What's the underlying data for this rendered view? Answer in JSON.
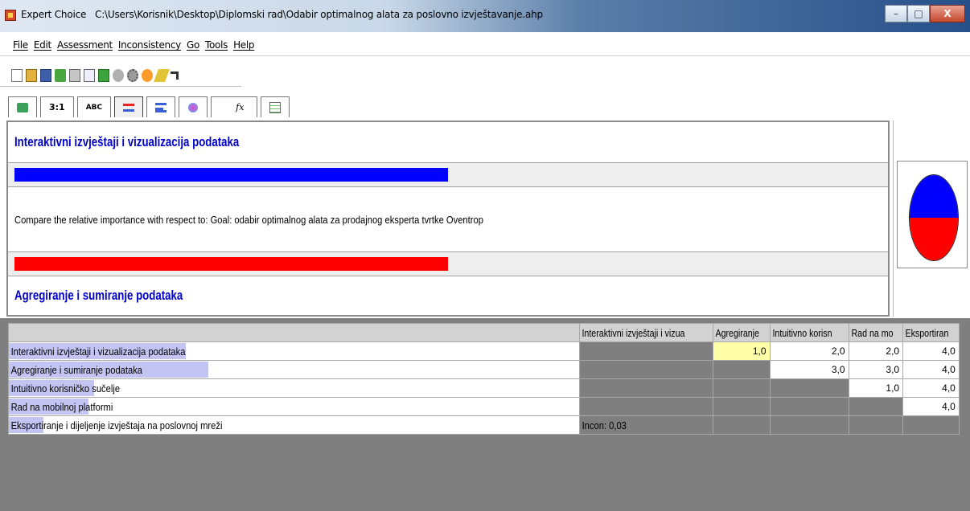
{
  "window": {
    "app_name": "Expert Choice",
    "path": "C:\\Users\\Korisnik\\Desktop\\Diplomski rad\\Odabir optimalnog alata za poslovno izvještavanje.ahp",
    "buttons": {
      "minimize": "–",
      "maximize": "□",
      "close": "X"
    }
  },
  "menu": [
    "File",
    "Edit",
    "Assessment",
    "Inconsistency",
    "Go",
    "Tools",
    "Help"
  ],
  "toolbar_icons": [
    "new-file-icon",
    "open-folder-icon",
    "save-disk-icon",
    "checkmark-icon",
    "print-icon",
    "print-preview-icon",
    "calculator-icon",
    "grey-tool-icon",
    "gear-icon",
    "redo-icon",
    "magic-wand-icon",
    "arrow-up-right-icon"
  ],
  "tabs": [
    {
      "name": "tab-tree-view",
      "label": ""
    },
    {
      "name": "tab-numerical",
      "label": "3:1"
    },
    {
      "name": "tab-verbal",
      "label": "ABC"
    },
    {
      "name": "tab-graphical",
      "label": ""
    },
    {
      "name": "tab-bars",
      "label": ""
    },
    {
      "name": "tab-graph",
      "label": ""
    },
    {
      "name": "tab-formula",
      "label": "fx"
    },
    {
      "name": "tab-grid",
      "label": ""
    }
  ],
  "comparison": {
    "top_item": "Interaktivni izvještaji i vizualizacija podataka",
    "prompt": "Compare the relative importance with respect to: Goal: odabir optimalnog alata za prodajnog eksperta tvrtke Oventrop",
    "bottom_item": "Agregiranje i sumiranje podataka",
    "top_weight": 0.5,
    "bottom_weight": 0.5,
    "colors": {
      "top": "#0000ff",
      "bottom": "#ff0000"
    }
  },
  "matrix": {
    "columns": [
      "Interaktivni izvještaji i vizua",
      "Agregiranje",
      "Intuitivno korisn",
      "Rad na mo",
      "Eksportiran"
    ],
    "rows": [
      {
        "label": "Interaktivni izvještaji i vizualizacija podataka",
        "highlight": 0.31,
        "values": [
          "",
          "1,0",
          "2,0",
          "2,0",
          "4,0"
        ]
      },
      {
        "label": "Agregiranje i sumiranje podataka",
        "highlight": 0.35,
        "values": [
          "",
          "",
          "3,0",
          "3,0",
          "4,0"
        ]
      },
      {
        "label": "Intuitivno korisničko sučelje",
        "highlight": 0.15,
        "values": [
          "",
          "",
          "",
          "1,0",
          "4,0"
        ]
      },
      {
        "label": "Rad na mobilnoj platformi",
        "highlight": 0.14,
        "values": [
          "",
          "",
          "",
          "",
          "4,0"
        ]
      },
      {
        "label": "Eksportiranje i dijeljenje izvještaja na poslovnoj mreži",
        "highlight": 0.06,
        "values": [
          "Incon: 0,03",
          "",
          "",
          "",
          ""
        ]
      }
    ]
  }
}
